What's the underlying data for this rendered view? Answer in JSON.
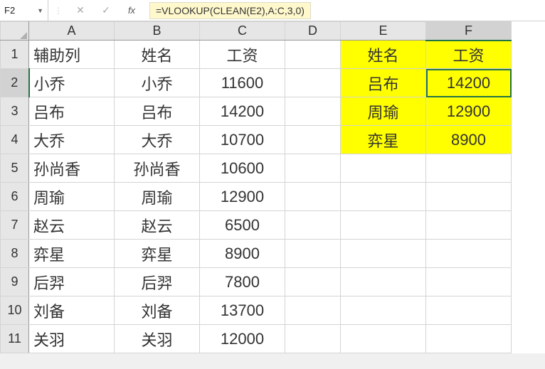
{
  "name_box": "F2",
  "formula": "=VLOOKUP(CLEAN(E2),A:C,3,0)",
  "columns": [
    "A",
    "B",
    "C",
    "D",
    "E",
    "F"
  ],
  "rows": [
    "1",
    "2",
    "3",
    "4",
    "5",
    "6",
    "7",
    "8",
    "9",
    "10",
    "11"
  ],
  "active_col": "F",
  "active_row": "2",
  "cells": {
    "A1": "辅助列",
    "B1": "姓名",
    "C1": "工资",
    "E1": "姓名",
    "F1": "工资",
    "A2": "小乔",
    "B2": "小乔",
    "C2": "11600",
    "E2": "吕布",
    "F2": "14200",
    "A3": "吕布",
    "B3": "吕布",
    "C3": "14200",
    "E3": "周瑜",
    "F3": "12900",
    "A4": "大乔",
    "B4": "大乔",
    "C4": "10700",
    "E4": "弈星",
    "F4": "8900",
    "A5": "孙尚香",
    "B5": "孙尚香",
    "C5": "10600",
    "A6": "周瑜",
    "B6": "周瑜",
    "C6": "12900",
    "A7": "赵云",
    "B7": "赵云",
    "C7": "6500",
    "A8": "弈星",
    "B8": "弈星",
    "C8": "8900",
    "A9": "后羿",
    "B9": "后羿",
    "C9": "7800",
    "A10": "刘备",
    "B10": "刘备",
    "C10": "13700",
    "A11": "关羽",
    "B11": "关羽",
    "C11": "12000"
  },
  "chart_data": {
    "type": "table",
    "main_table": {
      "headers": [
        "辅助列",
        "姓名",
        "工资"
      ],
      "rows": [
        [
          "小乔",
          "小乔",
          11600
        ],
        [
          "吕布",
          "吕布",
          14200
        ],
        [
          "大乔",
          "大乔",
          10700
        ],
        [
          "孙尚香",
          "孙尚香",
          10600
        ],
        [
          "周瑜",
          "周瑜",
          12900
        ],
        [
          "赵云",
          "赵云",
          6500
        ],
        [
          "弈星",
          "弈星",
          8900
        ],
        [
          "后羿",
          "后羿",
          7800
        ],
        [
          "刘备",
          "刘备",
          13700
        ],
        [
          "关羽",
          "关羽",
          12000
        ]
      ]
    },
    "lookup_table": {
      "headers": [
        "姓名",
        "工资"
      ],
      "rows": [
        [
          "吕布",
          14200
        ],
        [
          "周瑜",
          12900
        ],
        [
          "弈星",
          8900
        ]
      ]
    }
  }
}
